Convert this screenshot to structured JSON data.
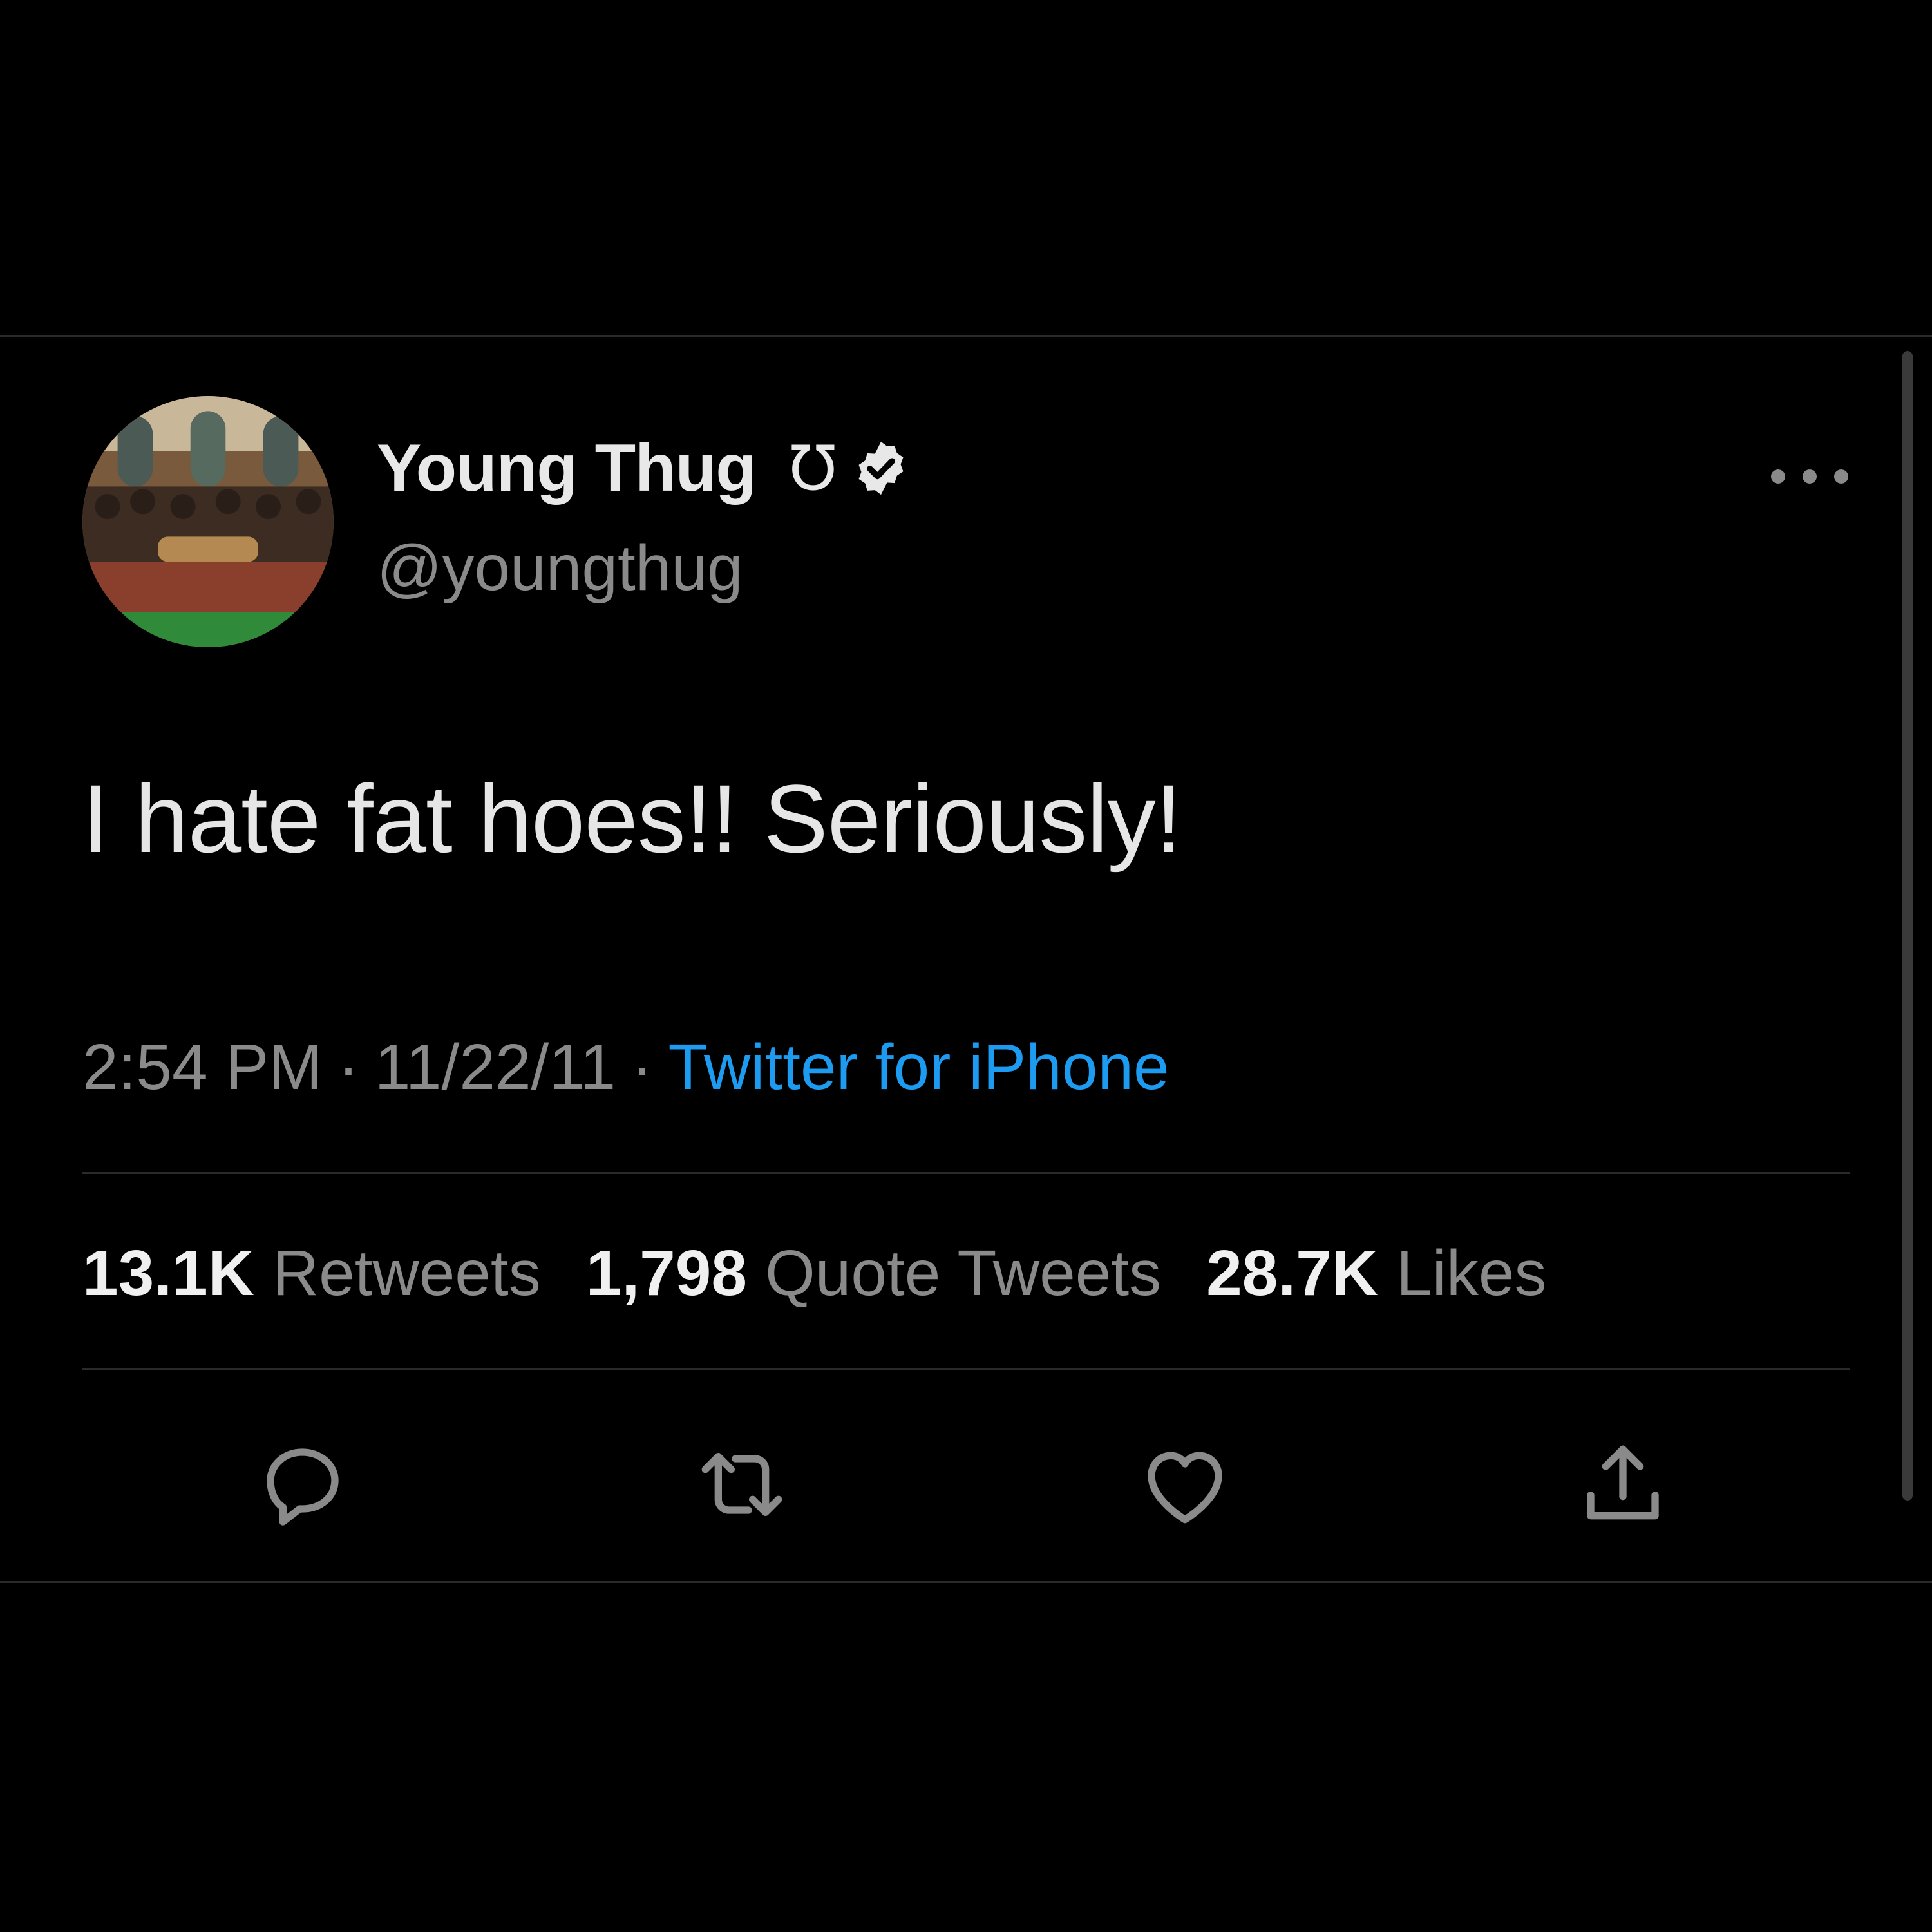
{
  "user": {
    "display_name": "Young Thug",
    "name_glyph": "Ʊ",
    "handle": "@youngthug",
    "verified": true
  },
  "tweet": {
    "text": "I hate fat hoes!! Seriously!"
  },
  "meta": {
    "time": "2:54 PM",
    "date": "11/22/11",
    "separator": "·",
    "source": "Twitter for iPhone"
  },
  "stats": [
    {
      "value": "13.1K",
      "label": "Retweets"
    },
    {
      "value": "1,798",
      "label": "Quote Tweets"
    },
    {
      "value": "28.7K",
      "label": "Likes"
    }
  ],
  "actions": [
    {
      "icon": "reply-icon"
    },
    {
      "icon": "retweet-icon"
    },
    {
      "icon": "like-icon"
    },
    {
      "icon": "share-icon"
    }
  ],
  "colors": {
    "background": "#000000",
    "accent": "#1d9bf0",
    "secondary_text": "#8a8a8a",
    "primary_text": "#e6e6e6"
  }
}
